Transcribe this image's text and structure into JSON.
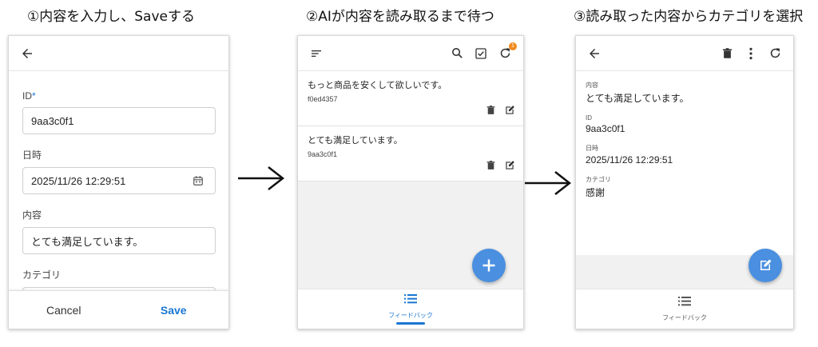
{
  "steps": [
    {
      "title": "①内容を入力し、Saveする"
    },
    {
      "title": "②AIが内容を読み取るまで待つ"
    },
    {
      "title": "③読み取った内容からカテゴリを選択"
    }
  ],
  "form_screen": {
    "fields": [
      {
        "label": "ID",
        "required_mark": "*",
        "value": "9aa3c0f1"
      },
      {
        "label": "日時",
        "value": "2025/11/26 12:29:51"
      },
      {
        "label": "内容",
        "value": "とても満足しています。"
      },
      {
        "label": "カテゴリ",
        "value": ""
      }
    ],
    "cancel_label": "Cancel",
    "save_label": "Save"
  },
  "list_screen": {
    "badge_count": "1",
    "items": [
      {
        "text": "もっと商品を安くして欲しいです。",
        "id": "f0ed4357"
      },
      {
        "text": "とても満足しています。",
        "id": "9aa3c0f1"
      }
    ],
    "nav_label": "フィードバック"
  },
  "detail_screen": {
    "rows": [
      {
        "label": "内容",
        "value": "とても満足しています。"
      },
      {
        "label": "ID",
        "value": "9aa3c0f1"
      },
      {
        "label": "日時",
        "value": "2025/11/26 12:29:51"
      },
      {
        "label": "カテゴリ",
        "value": "感謝"
      }
    ],
    "nav_label": "フィードバック"
  },
  "colors": {
    "accent": "#1976d2",
    "fab": "#4a8fe0",
    "badge": "#f08a1c"
  }
}
